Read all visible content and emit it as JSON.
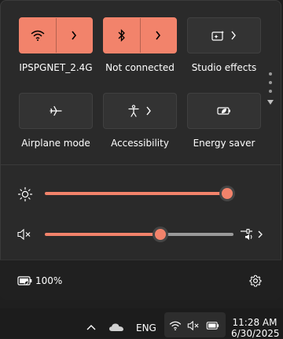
{
  "quick_settings": {
    "tiles_row1": [
      {
        "label": "IPSPGNET_2.4G",
        "icon": "wifi-icon",
        "active": true
      },
      {
        "label": "Not connected",
        "icon": "bluetooth-icon",
        "active": true
      },
      {
        "label": "Studio effects",
        "icon": "studio-effects-icon",
        "active": false
      }
    ],
    "tiles_row2": [
      {
        "label": "Airplane mode",
        "icon": "airplane-icon",
        "active": false
      },
      {
        "label": "Accessibility",
        "icon": "accessibility-icon",
        "active": false
      },
      {
        "label": "Energy saver",
        "icon": "energy-saver-icon",
        "active": false
      }
    ],
    "brightness": {
      "value": 100
    },
    "volume": {
      "value": 60,
      "muted": true
    },
    "battery": {
      "percent_label": "100%"
    },
    "colors": {
      "accent": "#f2836b",
      "tile_off": "#333333",
      "panel": "#2a2a2a"
    }
  },
  "taskbar": {
    "language": "ENG",
    "time": "11:28 AM",
    "date": "6/30/2025"
  }
}
